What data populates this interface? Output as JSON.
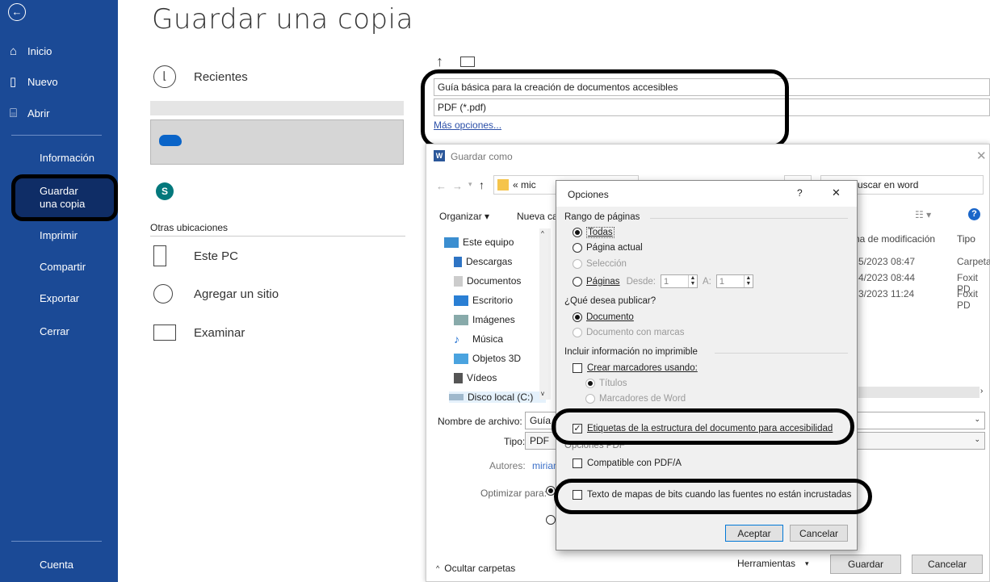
{
  "page_title": "Guardar una copia",
  "nav": {
    "back_icon": "back-arrow-icon",
    "inicio": "Inicio",
    "nuevo": "Nuevo",
    "abrir": "Abrir",
    "informacion": "Información",
    "guardar_copia": "Guardar una copia",
    "imprimir": "Imprimir",
    "compartir": "Compartir",
    "exportar": "Exportar",
    "cerrar": "Cerrar",
    "cuenta": "Cuenta"
  },
  "locations": {
    "recientes": "Recientes",
    "otras_ubicaciones": "Otras ubicaciones",
    "este_pc": "Este PC",
    "agregar_sitio": "Agregar un sitio",
    "examinar": "Examinar"
  },
  "file": {
    "name": "Guía básica para la creación de documentos accesibles",
    "type": "PDF (*.pdf)",
    "mas_opciones": "Más opciones..."
  },
  "saveas": {
    "title": "Guardar como",
    "path_crumb": "« mic",
    "search_placeholder": "uscar en word",
    "organizar": "Organizar ▾",
    "nueva_carpeta": "Nueva car",
    "col_fecha": "ha de modificación",
    "col_tipo": "Tipo",
    "rows": [
      {
        "fecha": "5/2023 08:47",
        "tipo": "Carpeta"
      },
      {
        "fecha": "4/2023 08:44",
        "tipo": "Foxit PD"
      },
      {
        "fecha": "3/2023 11:24",
        "tipo": "Foxit PD"
      }
    ],
    "tree": [
      "Este equipo",
      "Descargas",
      "Documentos",
      "Escritorio",
      "Imágenes",
      "Música",
      "Objetos 3D",
      "Vídeos",
      "Disco local (C:)"
    ],
    "nombre_label": "Nombre de archivo:",
    "nombre_value": "Guía b",
    "tipo_label": "Tipo:",
    "tipo_value": "PDF",
    "autores_label": "Autores:",
    "autores_value": "mirian",
    "optimizar_label": "Optimizar para:",
    "ocultar": "Ocultar carpetas",
    "herramientas": "Herramientas",
    "guardar": "Guardar",
    "cancelar": "Cancelar"
  },
  "options": {
    "title": "Opciones",
    "help": "?",
    "close": "✕",
    "rango": "Rango de páginas",
    "todas": "Todas",
    "pagina_actual": "Página actual",
    "seleccion": "Selección",
    "paginas": "Páginas",
    "desde": "Desde:",
    "desde_val": "1",
    "a": "A:",
    "a_val": "1",
    "que_publicar": "¿Qué desea publicar?",
    "documento": "Documento",
    "documento_marcas": "Documento con marcas",
    "incluir": "Incluir información no imprimible",
    "crear_marcadores": "Crear marcadores usando:",
    "titulos": "Títulos",
    "marcadores_word": "Marcadores de Word",
    "etiquetas": "Etiquetas de la estructura del documento para accesibilidad",
    "opciones_pdf": "Opciones PDF",
    "compatible": "Compatible con PDF/A",
    "texto_mapas": "Texto de mapas de bits cuando las fuentes no están incrustadas",
    "aceptar": "Aceptar",
    "cancelar": "Cancelar"
  }
}
